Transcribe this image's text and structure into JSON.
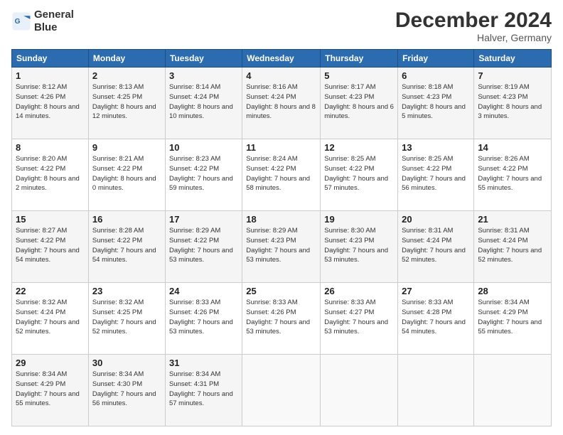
{
  "header": {
    "logo_line1": "General",
    "logo_line2": "Blue",
    "month": "December 2024",
    "location": "Halver, Germany"
  },
  "days_of_week": [
    "Sunday",
    "Monday",
    "Tuesday",
    "Wednesday",
    "Thursday",
    "Friday",
    "Saturday"
  ],
  "weeks": [
    [
      {
        "num": "1",
        "rise": "8:12 AM",
        "set": "4:26 PM",
        "daylight": "8 hours and 14 minutes."
      },
      {
        "num": "2",
        "rise": "8:13 AM",
        "set": "4:25 PM",
        "daylight": "8 hours and 12 minutes."
      },
      {
        "num": "3",
        "rise": "8:14 AM",
        "set": "4:24 PM",
        "daylight": "8 hours and 10 minutes."
      },
      {
        "num": "4",
        "rise": "8:16 AM",
        "set": "4:24 PM",
        "daylight": "8 hours and 8 minutes."
      },
      {
        "num": "5",
        "rise": "8:17 AM",
        "set": "4:23 PM",
        "daylight": "8 hours and 6 minutes."
      },
      {
        "num": "6",
        "rise": "8:18 AM",
        "set": "4:23 PM",
        "daylight": "8 hours and 5 minutes."
      },
      {
        "num": "7",
        "rise": "8:19 AM",
        "set": "4:23 PM",
        "daylight": "8 hours and 3 minutes."
      }
    ],
    [
      {
        "num": "8",
        "rise": "8:20 AM",
        "set": "4:22 PM",
        "daylight": "8 hours and 2 minutes."
      },
      {
        "num": "9",
        "rise": "8:21 AM",
        "set": "4:22 PM",
        "daylight": "8 hours and 0 minutes."
      },
      {
        "num": "10",
        "rise": "8:23 AM",
        "set": "4:22 PM",
        "daylight": "7 hours and 59 minutes."
      },
      {
        "num": "11",
        "rise": "8:24 AM",
        "set": "4:22 PM",
        "daylight": "7 hours and 58 minutes."
      },
      {
        "num": "12",
        "rise": "8:25 AM",
        "set": "4:22 PM",
        "daylight": "7 hours and 57 minutes."
      },
      {
        "num": "13",
        "rise": "8:25 AM",
        "set": "4:22 PM",
        "daylight": "7 hours and 56 minutes."
      },
      {
        "num": "14",
        "rise": "8:26 AM",
        "set": "4:22 PM",
        "daylight": "7 hours and 55 minutes."
      }
    ],
    [
      {
        "num": "15",
        "rise": "8:27 AM",
        "set": "4:22 PM",
        "daylight": "7 hours and 54 minutes."
      },
      {
        "num": "16",
        "rise": "8:28 AM",
        "set": "4:22 PM",
        "daylight": "7 hours and 54 minutes."
      },
      {
        "num": "17",
        "rise": "8:29 AM",
        "set": "4:22 PM",
        "daylight": "7 hours and 53 minutes."
      },
      {
        "num": "18",
        "rise": "8:29 AM",
        "set": "4:23 PM",
        "daylight": "7 hours and 53 minutes."
      },
      {
        "num": "19",
        "rise": "8:30 AM",
        "set": "4:23 PM",
        "daylight": "7 hours and 53 minutes."
      },
      {
        "num": "20",
        "rise": "8:31 AM",
        "set": "4:24 PM",
        "daylight": "7 hours and 52 minutes."
      },
      {
        "num": "21",
        "rise": "8:31 AM",
        "set": "4:24 PM",
        "daylight": "7 hours and 52 minutes."
      }
    ],
    [
      {
        "num": "22",
        "rise": "8:32 AM",
        "set": "4:24 PM",
        "daylight": "7 hours and 52 minutes."
      },
      {
        "num": "23",
        "rise": "8:32 AM",
        "set": "4:25 PM",
        "daylight": "7 hours and 52 minutes."
      },
      {
        "num": "24",
        "rise": "8:33 AM",
        "set": "4:26 PM",
        "daylight": "7 hours and 53 minutes."
      },
      {
        "num": "25",
        "rise": "8:33 AM",
        "set": "4:26 PM",
        "daylight": "7 hours and 53 minutes."
      },
      {
        "num": "26",
        "rise": "8:33 AM",
        "set": "4:27 PM",
        "daylight": "7 hours and 53 minutes."
      },
      {
        "num": "27",
        "rise": "8:33 AM",
        "set": "4:28 PM",
        "daylight": "7 hours and 54 minutes."
      },
      {
        "num": "28",
        "rise": "8:34 AM",
        "set": "4:29 PM",
        "daylight": "7 hours and 55 minutes."
      }
    ],
    [
      {
        "num": "29",
        "rise": "8:34 AM",
        "set": "4:29 PM",
        "daylight": "7 hours and 55 minutes."
      },
      {
        "num": "30",
        "rise": "8:34 AM",
        "set": "4:30 PM",
        "daylight": "7 hours and 56 minutes."
      },
      {
        "num": "31",
        "rise": "8:34 AM",
        "set": "4:31 PM",
        "daylight": "7 hours and 57 minutes."
      },
      null,
      null,
      null,
      null
    ]
  ]
}
